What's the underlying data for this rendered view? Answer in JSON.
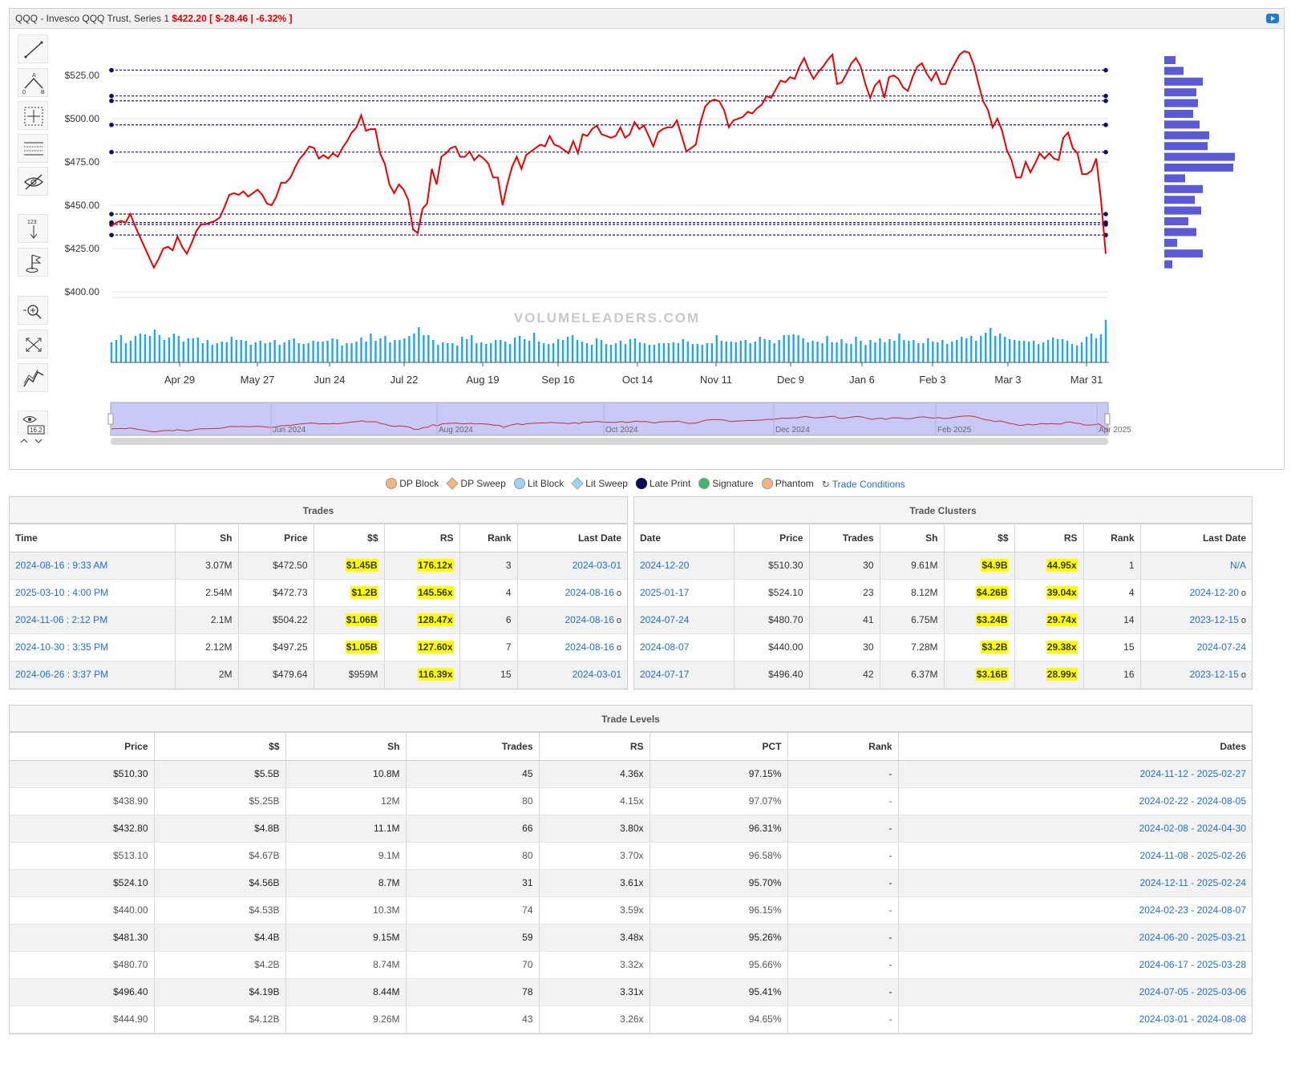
{
  "header": {
    "title": "QQQ - Invesco QQQ Trust, Series 1",
    "price": "$422.20",
    "change": "[ $-28.46 | -6.32% ]"
  },
  "toolbar": {
    "tools": [
      "line-tool-icon",
      "fibonacci-icon",
      "crosshair-box-icon",
      "horizontal-lines-icon",
      "hide-icon",
      "measure-icon",
      "flag-icon",
      "zoom-in-icon",
      "fullscreen-icon",
      "indicator-icon",
      "eye-value-icon"
    ],
    "annotation_value": "16.2"
  },
  "chart_data": {
    "type": "line",
    "yticks": [
      "$525.00",
      "$500.00",
      "$475.00",
      "$450.00",
      "$425.00",
      "$400.00"
    ],
    "ylim": [
      400,
      540
    ],
    "xticks": [
      "Apr 29",
      "May 27",
      "Jun 24",
      "Jul 22",
      "Aug 19",
      "Sep 16",
      "Oct 14",
      "Nov 11",
      "Dec 9",
      "Jan 6",
      "Feb 3",
      "Mar 3",
      "Mar 31"
    ],
    "series": [
      {
        "color": "#e00000",
        "values": [
          438,
          440,
          441,
          440,
          445,
          438,
          432,
          426,
          420,
          414,
          419,
          425,
          426,
          424,
          432,
          426,
          422,
          428,
          435,
          439,
          439,
          440,
          441,
          443,
          449,
          456,
          457,
          456,
          458,
          455,
          457,
          459,
          456,
          451,
          450,
          455,
          463,
          463,
          466,
          472,
          477,
          480,
          484,
          483,
          477,
          479,
          477,
          480,
          478,
          483,
          487,
          492,
          495,
          502,
          493,
          494,
          494,
          480,
          474,
          462,
          457,
          462,
          459,
          453,
          436,
          434,
          448,
          451,
          471,
          462,
          478,
          480,
          483,
          484,
          478,
          478,
          481,
          476,
          479,
          477,
          474,
          466,
          466,
          450,
          462,
          472,
          478,
          471,
          479,
          481,
          483,
          485,
          484,
          490,
          485,
          484,
          482,
          480,
          487,
          480,
          491,
          490,
          494,
          496,
          491,
          490,
          489,
          490,
          495,
          489,
          491,
          498,
          494,
          496,
          490,
          484,
          492,
          494,
          495,
          495,
          499,
          490,
          481,
          483,
          485,
          498,
          507,
          510,
          511,
          510,
          505,
          495,
          499,
          500,
          501,
          504,
          503,
          506,
          508,
          513,
          512,
          517,
          522,
          521,
          524,
          523,
          530,
          535,
          528,
          523,
          527,
          530,
          534,
          537,
          520,
          521,
          526,
          532,
          535,
          530,
          520,
          512,
          519,
          522,
          512,
          524,
          525,
          523,
          518,
          516,
          524,
          530,
          532,
          526,
          522,
          527,
          520,
          520,
          527,
          532,
          537,
          539,
          538,
          531,
          520,
          510,
          505,
          495,
          500,
          493,
          482,
          476,
          466,
          466,
          475,
          469,
          474,
          480,
          477,
          480,
          477,
          476,
          489,
          492,
          483,
          480,
          468,
          468,
          470,
          477,
          453,
          422
        ]
      }
    ],
    "volume": [
      25,
      28,
      34,
      24,
      27,
      33,
      36,
      35,
      33,
      41,
      34,
      28,
      31,
      36,
      33,
      26,
      30,
      30,
      31,
      24,
      28,
      22,
      24,
      26,
      25,
      32,
      28,
      28,
      27,
      22,
      25,
      27,
      24,
      25,
      28,
      22,
      25,
      28,
      30,
      24,
      23,
      24,
      27,
      26,
      26,
      27,
      30,
      29,
      21,
      24,
      24,
      26,
      31,
      26,
      36,
      27,
      30,
      33,
      25,
      28,
      28,
      30,
      33,
      36,
      44,
      34,
      34,
      28,
      22,
      25,
      24,
      24,
      21,
      32,
      29,
      34,
      24,
      25,
      23,
      24,
      28,
      28,
      26,
      23,
      31,
      33,
      29,
      27,
      37,
      26,
      24,
      23,
      24,
      29,
      28,
      32,
      34,
      28,
      26,
      24,
      22,
      30,
      28,
      23,
      22,
      24,
      27,
      23,
      29,
      30,
      25,
      24,
      22,
      22,
      24,
      24,
      24,
      25,
      24,
      29,
      26,
      23,
      23,
      22,
      24,
      24,
      34,
      27,
      26,
      26,
      25,
      27,
      28,
      24,
      26,
      32,
      29,
      28,
      24,
      28,
      34,
      34,
      35,
      34,
      30,
      25,
      27,
      26,
      24,
      33,
      25,
      25,
      29,
      24,
      23,
      32,
      27,
      22,
      28,
      25,
      30,
      25,
      29,
      27,
      36,
      28,
      27,
      28,
      24,
      24,
      30,
      26,
      25,
      28,
      23,
      26,
      28,
      32,
      30,
      33,
      27,
      33,
      37,
      43,
      33,
      36,
      32,
      29,
      28,
      27,
      27,
      26,
      27,
      23,
      25,
      28,
      31,
      29,
      29,
      27,
      23,
      21,
      25,
      32,
      36,
      30,
      35,
      53
    ]
  },
  "levels": {
    "prices": [
      528.0,
      513.1,
      510.3,
      496.4,
      480.7,
      444.9,
      440.0,
      438.9,
      432.8
    ],
    "volume_profile": [
      14,
      24,
      48,
      40,
      42,
      36,
      44,
      56,
      54,
      88,
      86,
      26,
      48,
      38,
      46,
      30,
      40,
      16,
      48,
      10
    ]
  },
  "navigator": {
    "labels": [
      "Jun 2024",
      "Aug 2024",
      "Oct 2024",
      "Dec 2024",
      "Feb 2025",
      "Apr 2025"
    ],
    "watermark": "VOLUMELEADERS.COM"
  },
  "legend": {
    "items": [
      {
        "label": "DP Block",
        "color": "#f7b183",
        "shape": "circle"
      },
      {
        "label": "DP Sweep",
        "color": "#f7b183",
        "shape": "diamond"
      },
      {
        "label": "Lit Block",
        "color": "#9fd3f5",
        "shape": "circle"
      },
      {
        "label": "Lit Sweep",
        "color": "#9fd3f5",
        "shape": "diamond"
      },
      {
        "label": "Late Print",
        "color": "#0b0b5a",
        "shape": "circle"
      },
      {
        "label": "Signature",
        "color": "#3cba6b",
        "shape": "circle"
      },
      {
        "label": "Phantom",
        "color": "#f7b183",
        "shape": "circle"
      }
    ],
    "conditions_link": "Trade Conditions"
  },
  "trades": {
    "title": "Trades",
    "columns": [
      "Time",
      "Sh",
      "Price",
      "$$",
      "RS",
      "Rank",
      "Last Date"
    ],
    "rows": [
      {
        "time": "2024-08-16 : 9:33 AM",
        "sh": "3.07M",
        "price": "$472.50",
        "dollars": "$1.45B",
        "dollars_hl": true,
        "rs": "176.12x",
        "rank": "3",
        "last_date": "2024-03-01",
        "marker": ""
      },
      {
        "time": "2025-03-10 : 4:00 PM",
        "sh": "2.54M",
        "price": "$472.73",
        "dollars": "$1.2B",
        "dollars_hl": true,
        "rs": "145.56x",
        "rank": "4",
        "last_date": "2024-08-16",
        "marker": "o"
      },
      {
        "time": "2024-11-06 : 2:12 PM",
        "sh": "2.1M",
        "price": "$504.22",
        "dollars": "$1.06B",
        "dollars_hl": true,
        "rs": "128.47x",
        "rank": "6",
        "last_date": "2024-08-16",
        "marker": "o"
      },
      {
        "time": "2024-10-30 : 3:35 PM",
        "sh": "2.12M",
        "price": "$497.25",
        "dollars": "$1.05B",
        "dollars_hl": true,
        "rs": "127.60x",
        "rank": "7",
        "last_date": "2024-08-16",
        "marker": "o"
      },
      {
        "time": "2024-06-26 : 3:37 PM",
        "sh": "2M",
        "price": "$479.64",
        "dollars": "$959M",
        "dollars_hl": false,
        "rs": "116.39x",
        "rank": "15",
        "last_date": "2024-03-01",
        "marker": ""
      }
    ]
  },
  "clusters": {
    "title": "Trade Clusters",
    "columns": [
      "Date",
      "Price",
      "Trades",
      "Sh",
      "$$",
      "RS",
      "Rank",
      "Last Date"
    ],
    "rows": [
      {
        "date": "2024-12-20",
        "price": "$510.30",
        "trades": "30",
        "sh": "9.61M",
        "dollars": "$4.9B",
        "rs": "44.95x",
        "rank": "1",
        "last_date": "N/A",
        "marker": ""
      },
      {
        "date": "2025-01-17",
        "price": "$524.10",
        "trades": "23",
        "sh": "8.12M",
        "dollars": "$4.26B",
        "rs": "39.04x",
        "rank": "4",
        "last_date": "2024-12-20",
        "marker": "o"
      },
      {
        "date": "2024-07-24",
        "price": "$480.70",
        "trades": "41",
        "sh": "6.75M",
        "dollars": "$3.24B",
        "rs": "29.74x",
        "rank": "14",
        "last_date": "2023-12-15",
        "marker": "o"
      },
      {
        "date": "2024-08-07",
        "price": "$440.00",
        "trades": "30",
        "sh": "7.28M",
        "dollars": "$3.2B",
        "rs": "29.38x",
        "rank": "15",
        "last_date": "2024-07-24",
        "marker": ""
      },
      {
        "date": "2024-07-17",
        "price": "$496.40",
        "trades": "42",
        "sh": "6.37M",
        "dollars": "$3.16B",
        "rs": "28.99x",
        "rank": "16",
        "last_date": "2023-12-15",
        "marker": "o"
      }
    ]
  },
  "levels_table": {
    "title": "Trade Levels",
    "columns": [
      "Price",
      "$$",
      "Sh",
      "Trades",
      "RS",
      "PCT",
      "Rank",
      "Dates"
    ],
    "rows": [
      {
        "price": "$510.30",
        "dollars": "$5.5B",
        "sh": "10.8M",
        "trades": "45",
        "rs": "4.36x",
        "pct": "97.15%",
        "rank": "-",
        "dates": "2024-11-12 - 2025-02-27"
      },
      {
        "price": "$438.90",
        "dollars": "$5.25B",
        "sh": "12M",
        "trades": "80",
        "rs": "4.15x",
        "pct": "97.07%",
        "rank": "-",
        "dates": "2024-02-22 - 2024-08-05"
      },
      {
        "price": "$432.80",
        "dollars": "$4.8B",
        "sh": "11.1M",
        "trades": "66",
        "rs": "3.80x",
        "pct": "96.31%",
        "rank": "-",
        "dates": "2024-02-08 - 2024-04-30"
      },
      {
        "price": "$513.10",
        "dollars": "$4.67B",
        "sh": "9.1M",
        "trades": "80",
        "rs": "3.70x",
        "pct": "96.58%",
        "rank": "-",
        "dates": "2024-11-08 - 2025-02-26"
      },
      {
        "price": "$524.10",
        "dollars": "$4.56B",
        "sh": "8.7M",
        "trades": "31",
        "rs": "3.61x",
        "pct": "95.70%",
        "rank": "-",
        "dates": "2024-12-11 - 2025-02-24"
      },
      {
        "price": "$440.00",
        "dollars": "$4.53B",
        "sh": "10.3M",
        "trades": "74",
        "rs": "3.59x",
        "pct": "96.15%",
        "rank": "-",
        "dates": "2024-02-23 - 2024-08-07"
      },
      {
        "price": "$481.30",
        "dollars": "$4.4B",
        "sh": "9.15M",
        "trades": "59",
        "rs": "3.48x",
        "pct": "95.26%",
        "rank": "-",
        "dates": "2024-06-20 - 2025-03-21"
      },
      {
        "price": "$480.70",
        "dollars": "$4.2B",
        "sh": "8.74M",
        "trades": "70",
        "rs": "3.32x",
        "pct": "95.66%",
        "rank": "-",
        "dates": "2024-06-17 - 2025-03-28"
      },
      {
        "price": "$496.40",
        "dollars": "$4.19B",
        "sh": "8.44M",
        "trades": "78",
        "rs": "3.31x",
        "pct": "95.41%",
        "rank": "-",
        "dates": "2024-07-05 - 2025-03-06"
      },
      {
        "price": "$444.90",
        "dollars": "$4.12B",
        "sh": "9.26M",
        "trades": "43",
        "rs": "3.26x",
        "pct": "94.65%",
        "rank": "-",
        "dates": "2024-03-01 - 2024-08-08"
      }
    ]
  }
}
